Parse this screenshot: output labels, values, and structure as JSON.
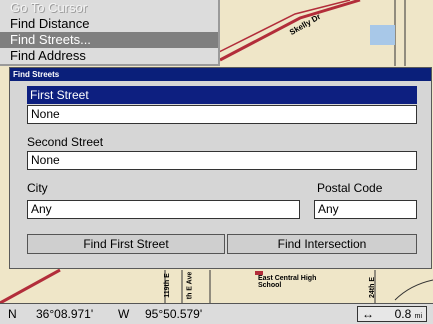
{
  "menu": {
    "items": [
      {
        "label": "Go To Cursor",
        "state": "disabled"
      },
      {
        "label": "Find Distance",
        "state": "normal"
      },
      {
        "label": "Find Streets...",
        "state": "selected"
      },
      {
        "label": "Find Address",
        "state": "partial"
      }
    ]
  },
  "map": {
    "labels": {
      "road_top": "Skelly Dr",
      "street_1": "119th E",
      "street_2": "th E Ave",
      "school": "East Central High School",
      "street_3": "24th E"
    }
  },
  "dialog": {
    "title": "Find Streets",
    "first_street_label": "First Street",
    "first_street_value": "None",
    "second_street_label": "Second Street",
    "second_street_value": "None",
    "city_label": "City",
    "city_value": "Any",
    "postal_label": "Postal Code",
    "postal_value": "Any",
    "find_first_button": "Find First Street",
    "find_intersection_button": "Find Intersection"
  },
  "status": {
    "lat_hemi": "N",
    "lat": "36°08.971'",
    "lon_hemi": "W",
    "lon": "95°50.579'",
    "scale_arrow": "↔",
    "scale_value": "0.8",
    "scale_unit": "mi"
  },
  "colors": {
    "map_bg": "#efe6c8",
    "road_red": "#b22d3a",
    "water_blue": "#a8c8e8",
    "title_bar": "#0a1f7a",
    "highlight": "#0d1f80"
  }
}
